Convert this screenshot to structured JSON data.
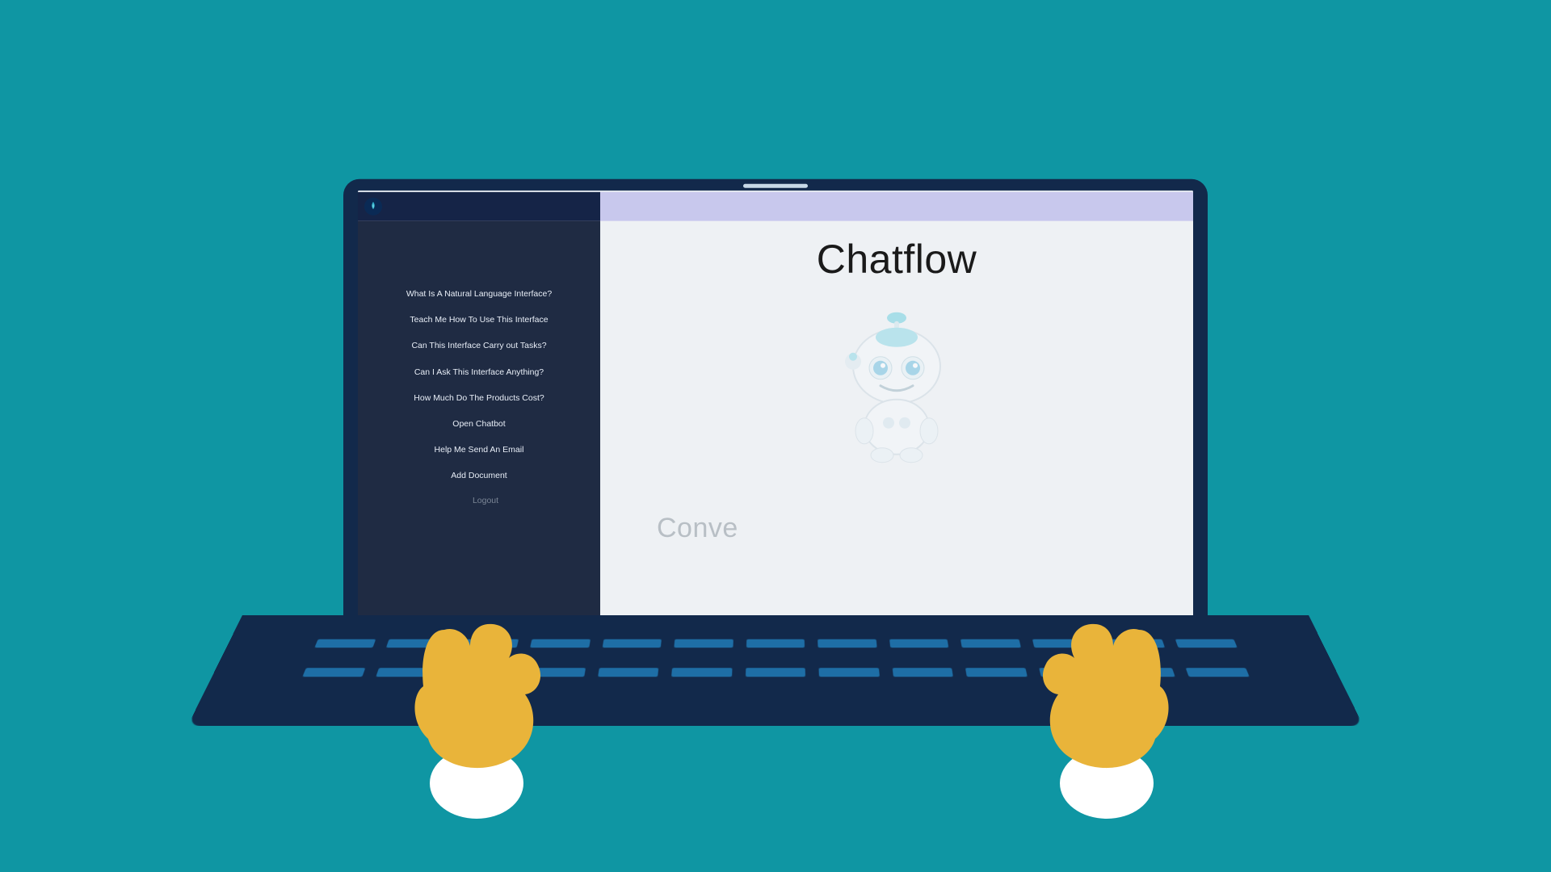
{
  "app": {
    "title": "Chatflow",
    "typed_text": "Conve"
  },
  "sidebar": {
    "items": [
      {
        "label": "What Is A Natural Language Interface?"
      },
      {
        "label": "Teach Me How To Use This Interface"
      },
      {
        "label": "Can This Interface Carry out Tasks?"
      },
      {
        "label": "Can I Ask This Interface Anything?"
      },
      {
        "label": "How Much Do The Products Cost?"
      },
      {
        "label": "Open Chatbot"
      },
      {
        "label": "Help Me Send An Email"
      },
      {
        "label": "Add Document"
      }
    ],
    "logout_label": "Logout"
  },
  "colors": {
    "page_bg": "#0f96a3",
    "laptop_frame": "#12294b",
    "sidebar_bg": "#1f2b43",
    "topbar_right": "#c8c8ed",
    "main_bg": "#eef1f4",
    "hand": "#e9b43a",
    "cuff": "#ffffff"
  }
}
